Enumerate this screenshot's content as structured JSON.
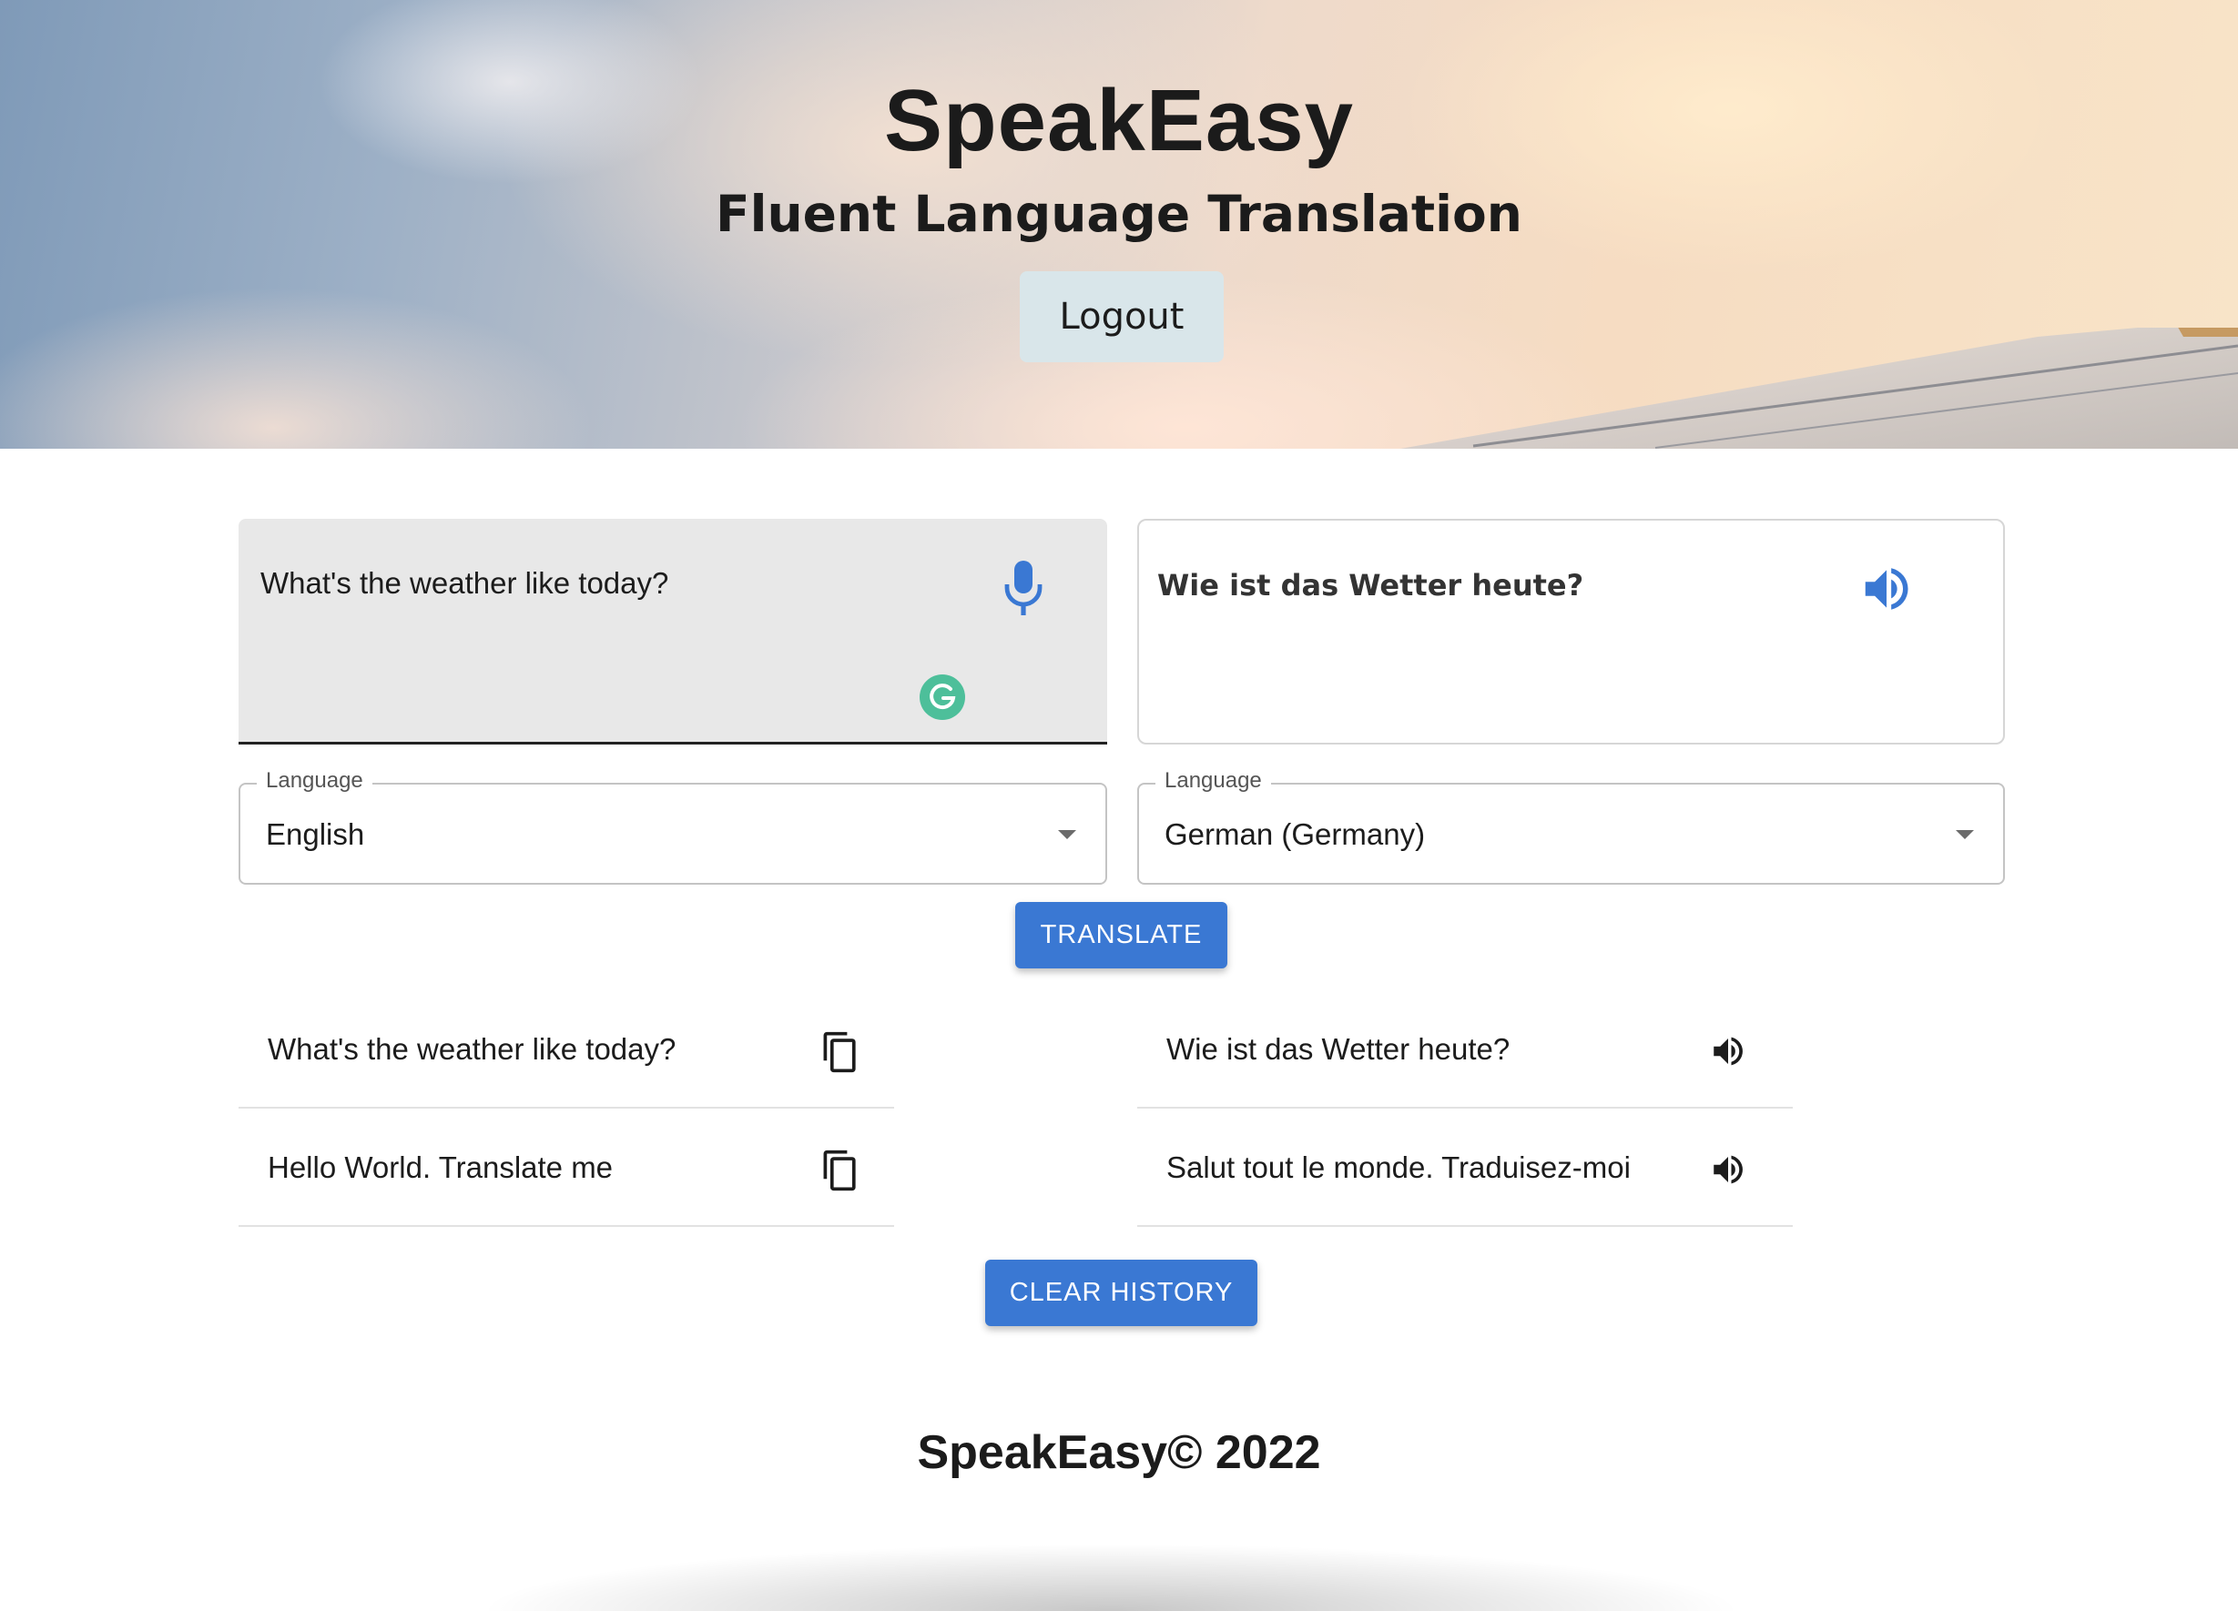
{
  "header": {
    "title": "SpeakEasy",
    "subtitle": "Fluent Language Translation",
    "logout_label": "Logout"
  },
  "translator": {
    "input_text": "What's the weather like today?",
    "output_text": "Wie ist das Wetter heute?",
    "source_language": {
      "label": "Language",
      "value": "English"
    },
    "target_language": {
      "label": "Language",
      "value": "German (Germany)"
    },
    "translate_label": "TRANSLATE",
    "icons": {
      "input": [
        "microphone-icon",
        "grammarly-icon"
      ],
      "output": [
        "speaker-icon"
      ]
    }
  },
  "history": {
    "items": [
      {
        "source": "What's the weather like today?",
        "translation": "Wie ist das Wetter heute?"
      },
      {
        "source": "Hello World. Translate me",
        "translation": "Salut tout le monde. Traduisez-moi"
      }
    ],
    "clear_label": "CLEAR HISTORY"
  },
  "footer": {
    "text": "SpeakEasy© 2022"
  },
  "colors": {
    "accent": "#3a78d3",
    "logout_bg": "#d9e6ea",
    "input_bg": "#e8e8e8",
    "grammarly": "#4dbf9a"
  }
}
